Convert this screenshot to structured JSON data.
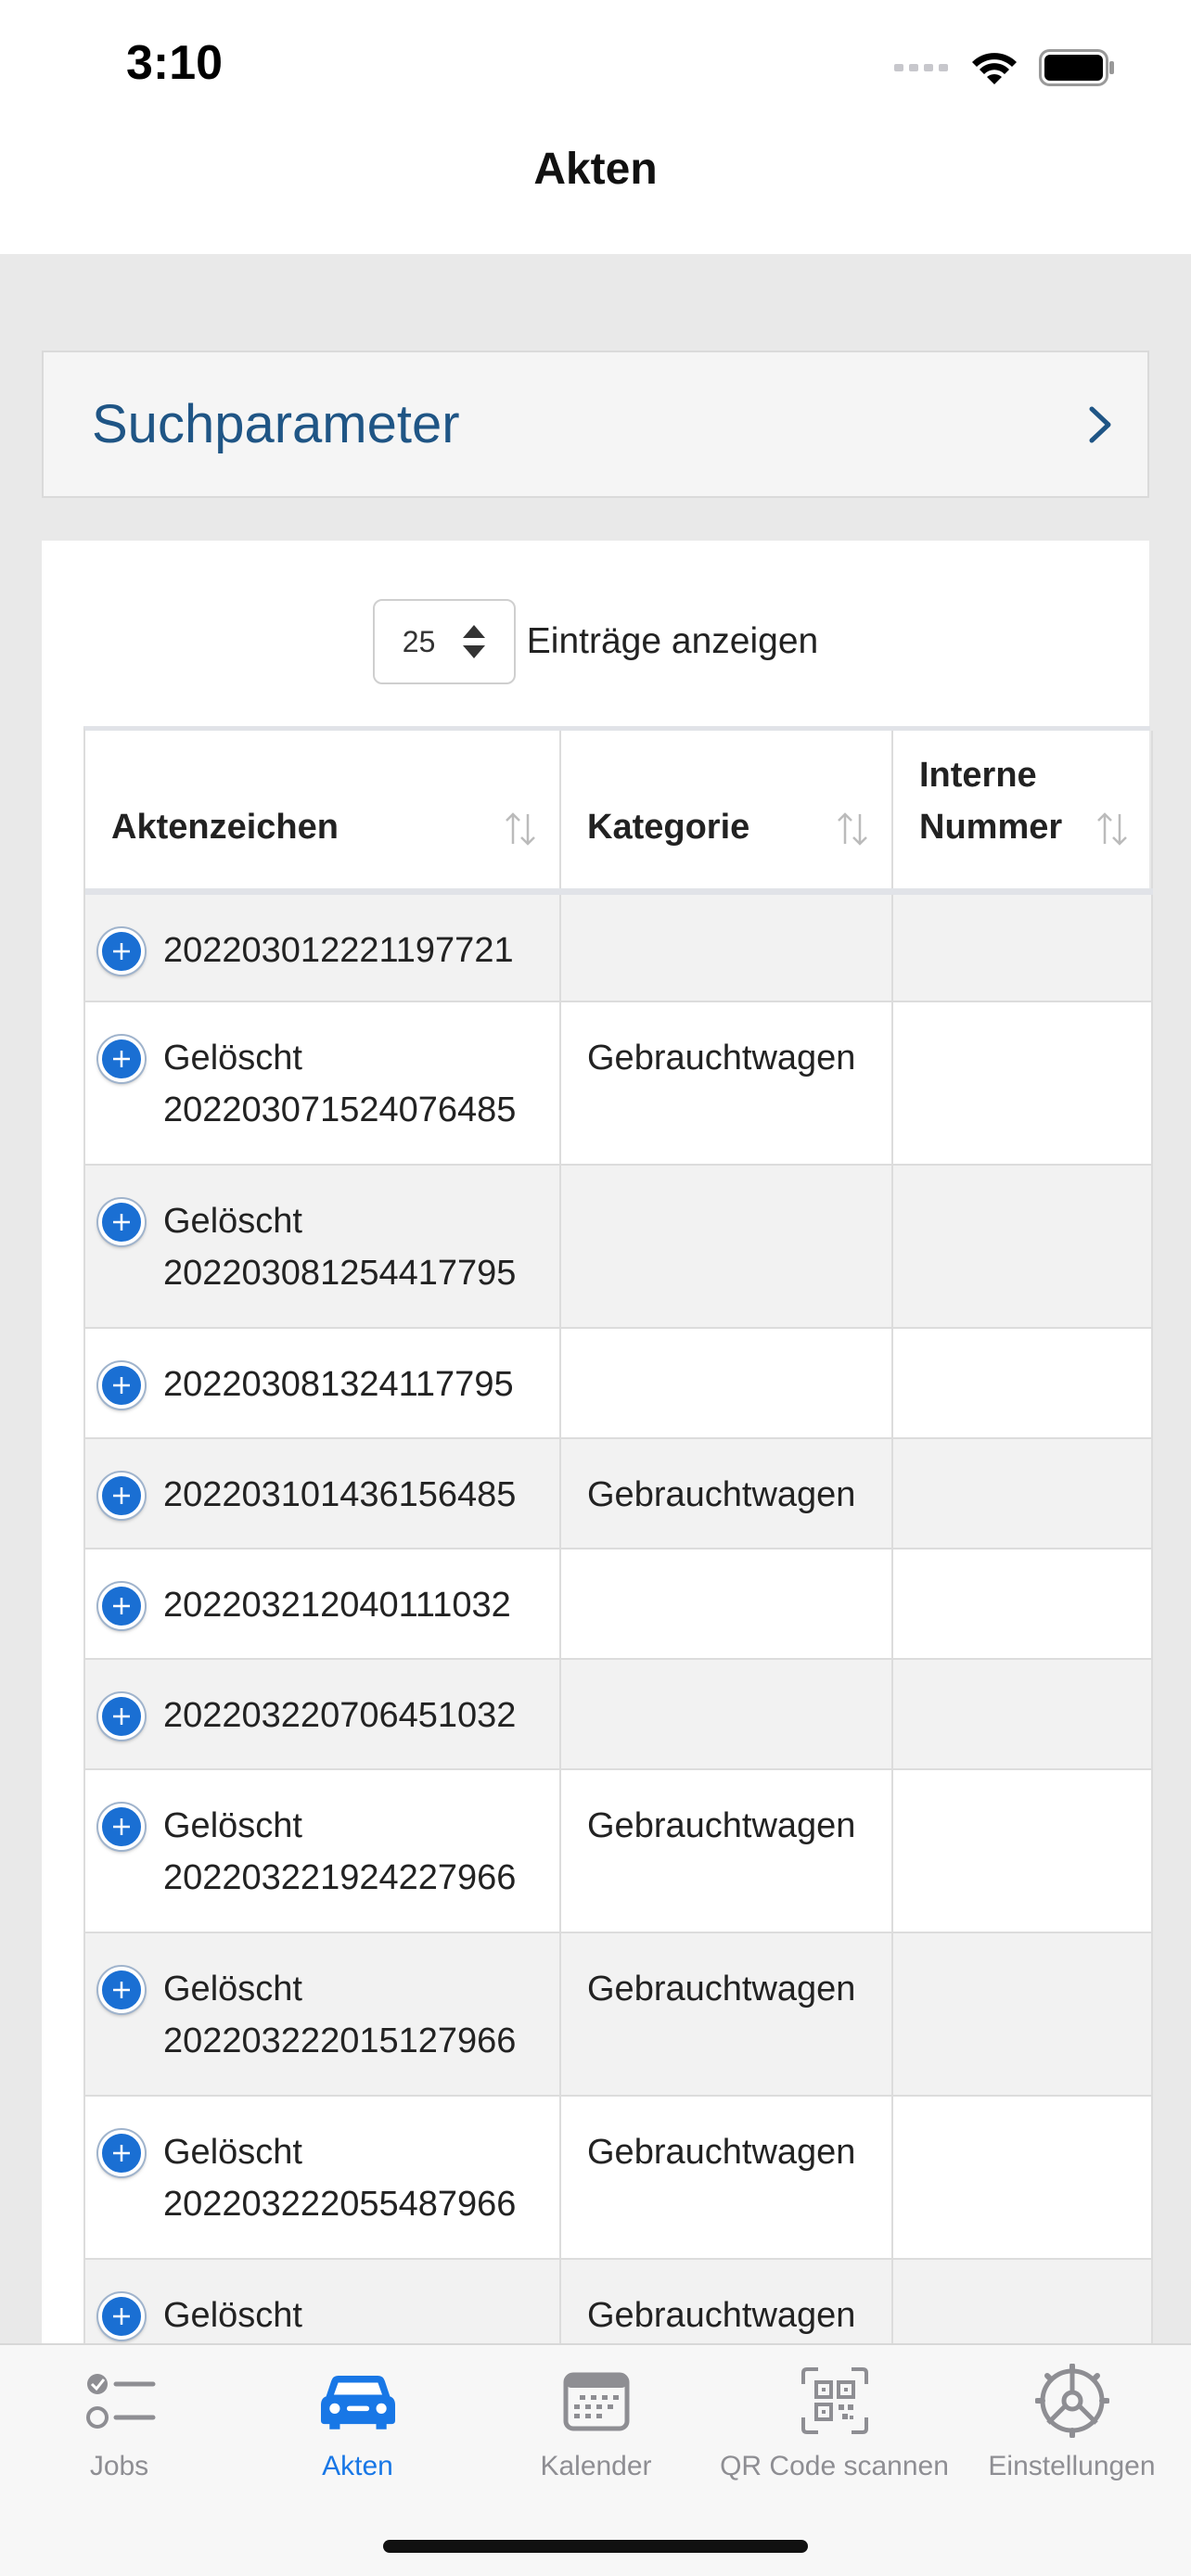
{
  "status_bar": {
    "time": "3:10"
  },
  "nav": {
    "title": "Akten"
  },
  "search": {
    "label": "Suchparameter"
  },
  "length": {
    "value": "25",
    "label": "Einträge anzeigen"
  },
  "table": {
    "headers": [
      "Aktenzeichen",
      "Kategorie",
      "Interne Nummer"
    ],
    "rows": [
      {
        "status": "",
        "number": "202203012221197721",
        "category": "",
        "internal": ""
      },
      {
        "status": "Gelöscht",
        "number": "202203071524076485",
        "category": "Gebrauchtwagen",
        "internal": ""
      },
      {
        "status": "Gelöscht",
        "number": "202203081254417795",
        "category": "",
        "internal": ""
      },
      {
        "status": "",
        "number": "202203081324117795",
        "category": "",
        "internal": ""
      },
      {
        "status": "",
        "number": "202203101436156485",
        "category": "Gebrauchtwagen",
        "internal": ""
      },
      {
        "status": "",
        "number": "202203212040111032",
        "category": "",
        "internal": ""
      },
      {
        "status": "",
        "number": "202203220706451032",
        "category": "",
        "internal": ""
      },
      {
        "status": "Gelöscht",
        "number": "202203221924227966",
        "category": "Gebrauchtwagen",
        "internal": ""
      },
      {
        "status": "Gelöscht",
        "number": "202203222015127966",
        "category": "Gebrauchtwagen",
        "internal": ""
      },
      {
        "status": "Gelöscht",
        "number": "202203222055487966",
        "category": "Gebrauchtwagen",
        "internal": ""
      },
      {
        "status": "Gelöscht",
        "number": "",
        "category": "Gebrauchtwagen",
        "internal": ""
      }
    ]
  },
  "tabs": [
    {
      "label": "Jobs",
      "icon": "checklist-icon",
      "active": false
    },
    {
      "label": "Akten",
      "icon": "car-icon",
      "active": true
    },
    {
      "label": "Kalender",
      "icon": "calendar-icon",
      "active": false
    },
    {
      "label": "QR Code scannen",
      "icon": "qr-code-icon",
      "active": false
    },
    {
      "label": "Einstellungen",
      "icon": "steering-wheel-icon",
      "active": false
    }
  ],
  "colors": {
    "accent": "#1877e6",
    "link": "#1f5585",
    "inactive": "#8e8e93"
  }
}
